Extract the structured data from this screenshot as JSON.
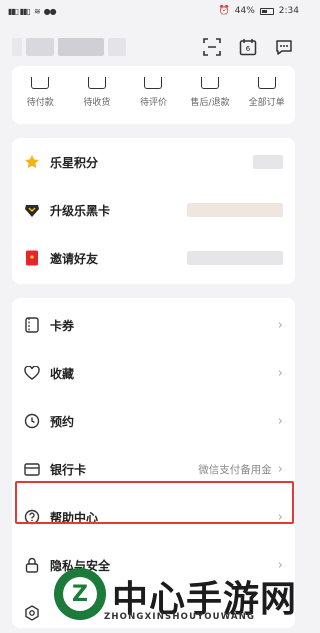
{
  "status_bar": {
    "battery": "44%",
    "time": "2:34"
  },
  "header": {
    "scan_icon": "scan-icon",
    "calendar_day": "6",
    "message_icon": "message-icon"
  },
  "orders": [
    {
      "label": "待付款",
      "icon": "wallet-icon"
    },
    {
      "label": "待收货",
      "icon": "truck-icon"
    },
    {
      "label": "待评价",
      "icon": "review-icon"
    },
    {
      "label": "售后/退款",
      "icon": "refund-icon"
    },
    {
      "label": "全部订单",
      "icon": "orders-icon"
    }
  ],
  "benefits": [
    {
      "label": "乐星积分",
      "icon": "star-icon"
    },
    {
      "label": "升级乐黑卡",
      "icon": "diamond-icon"
    },
    {
      "label": "邀请好友",
      "icon": "red-envelope-icon"
    }
  ],
  "menu": [
    {
      "label": "卡券",
      "icon": "ticket-icon",
      "value": ""
    },
    {
      "label": "收藏",
      "icon": "heart-icon",
      "value": ""
    },
    {
      "label": "预约",
      "icon": "clock-icon",
      "value": ""
    },
    {
      "label": "银行卡",
      "icon": "card-icon",
      "value": "微信支付备用金"
    },
    {
      "label": "帮助中心",
      "icon": "help-icon",
      "value": ""
    },
    {
      "label": "隐私与安全",
      "icon": "lock-icon",
      "value": ""
    }
  ],
  "watermark": {
    "title": "中心手游网",
    "subtitle": "ZHONGXINSHOUYOUWANG",
    "logo_letter": "Z"
  },
  "colors": {
    "highlight": "#e23b36",
    "star": "#f6b21b",
    "envelope": "#e5262b"
  }
}
